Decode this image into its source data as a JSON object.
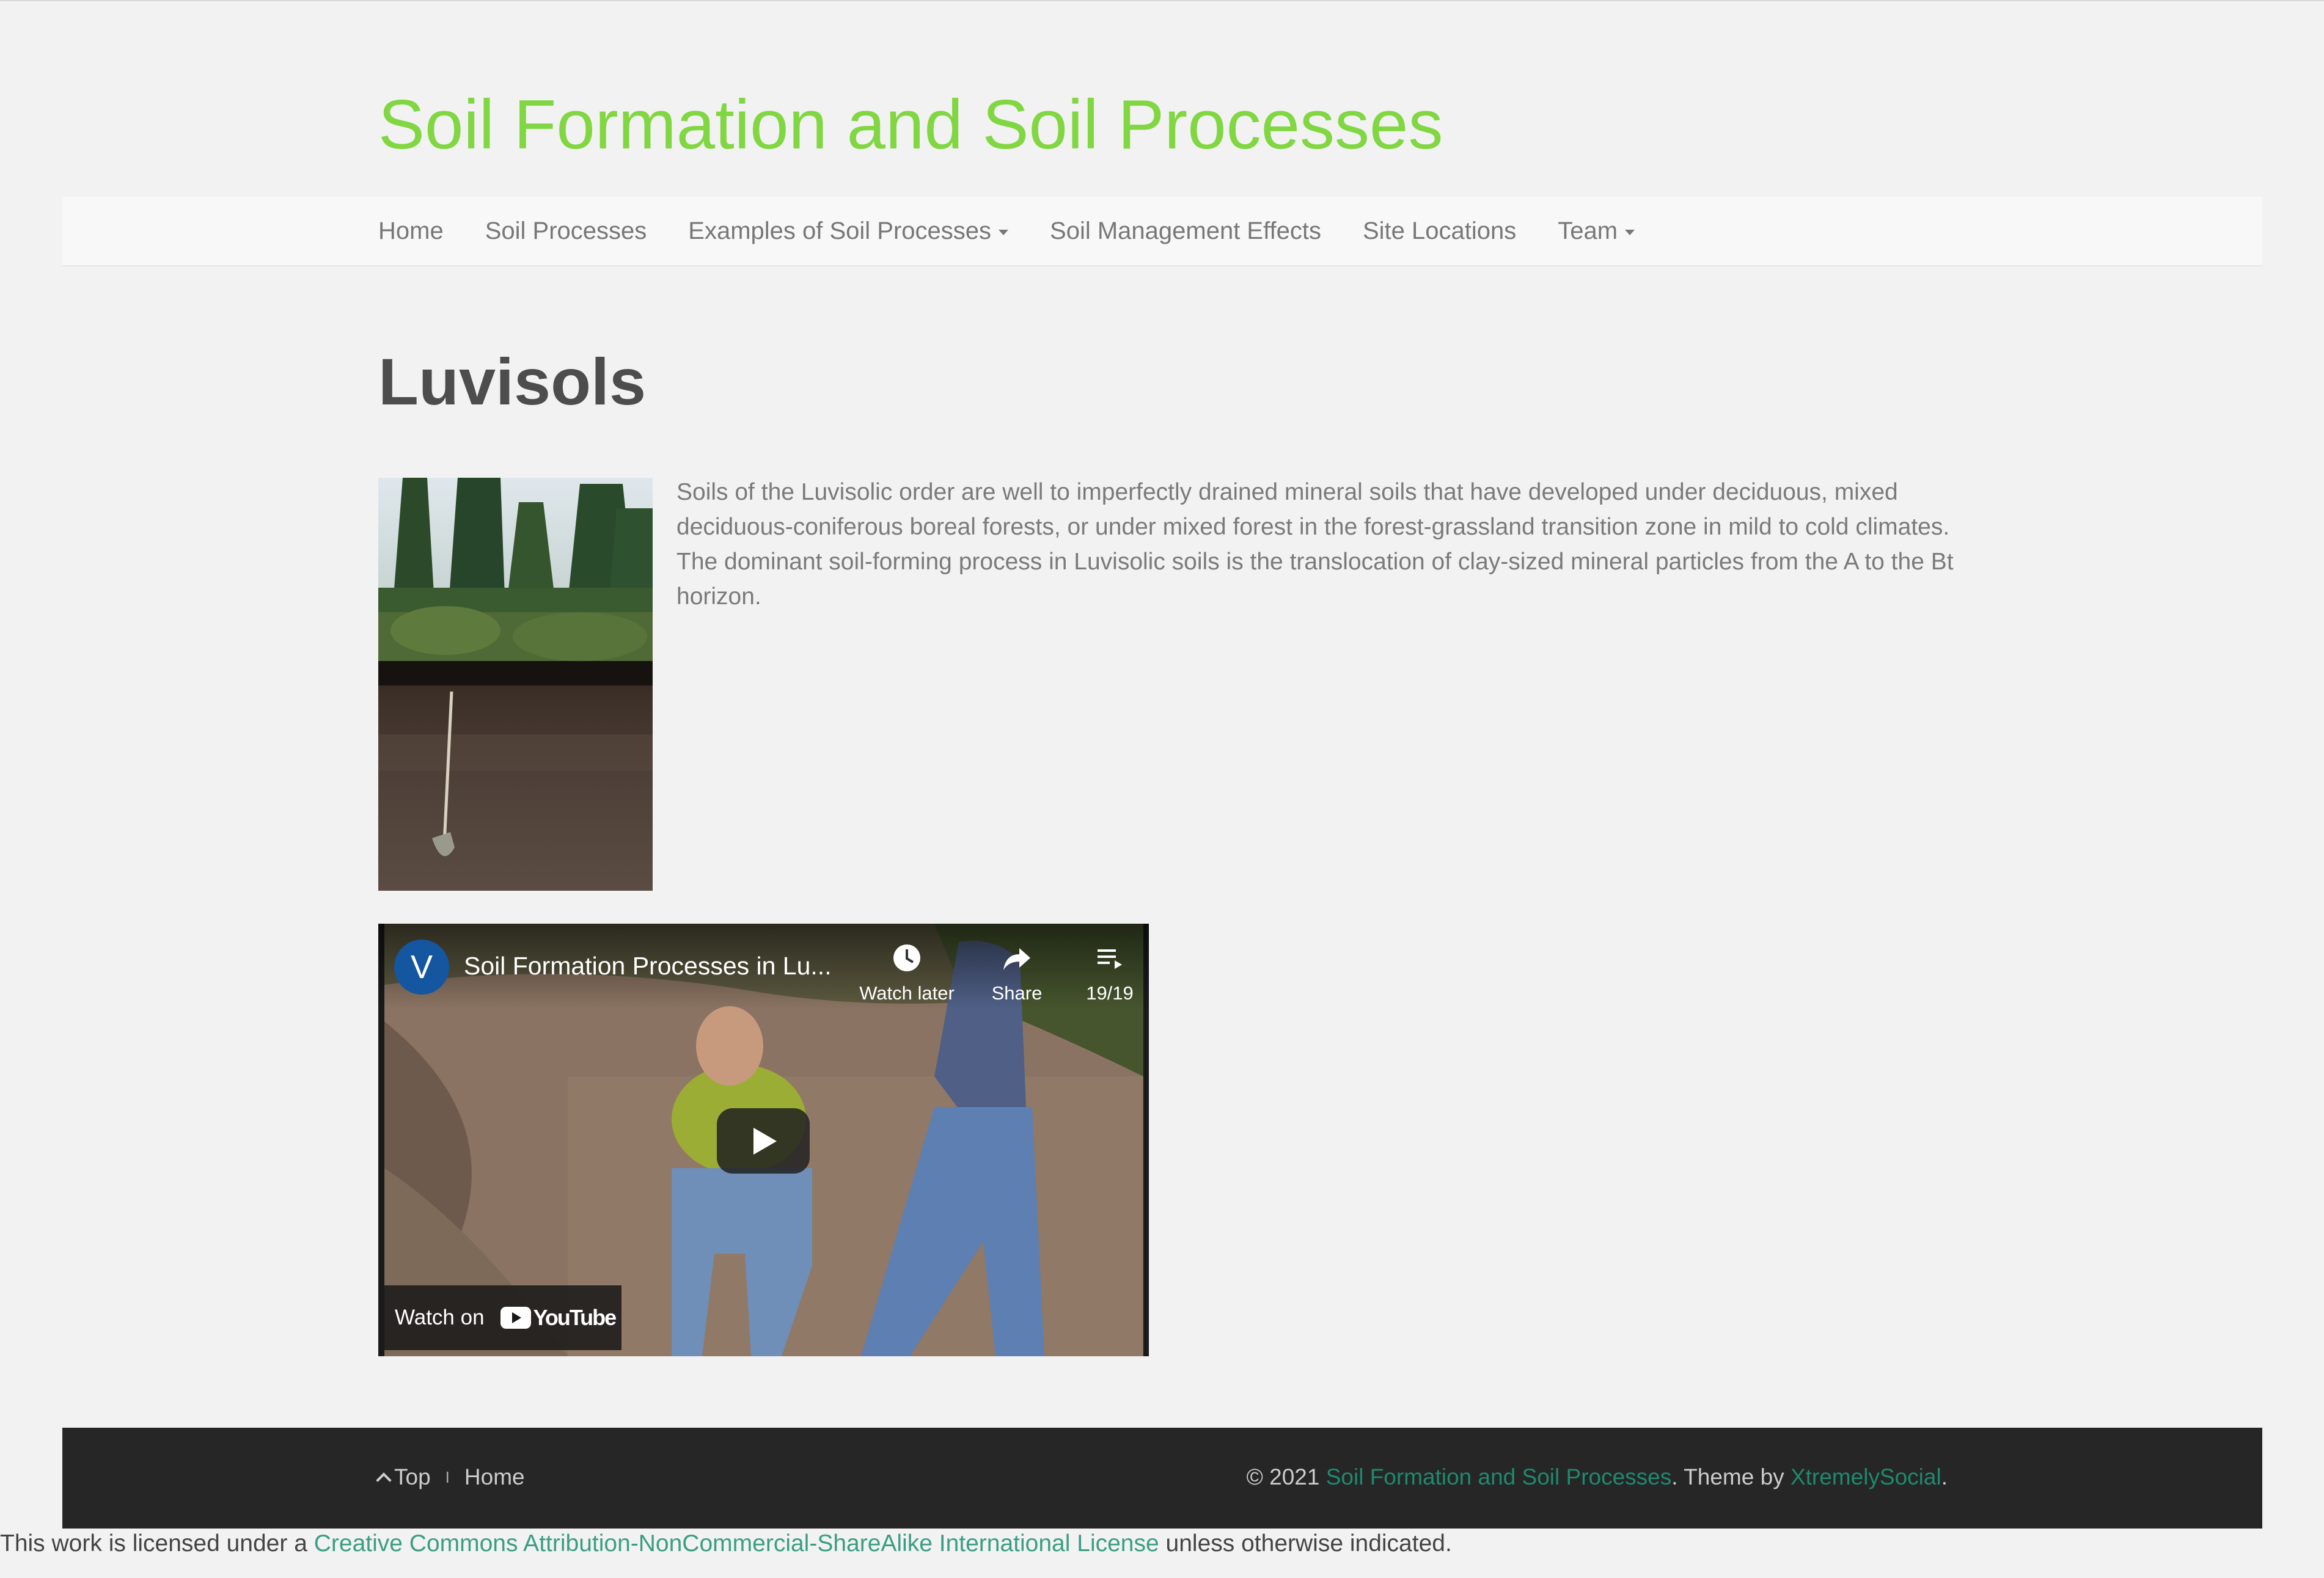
{
  "site": {
    "title": "Soil Formation and Soil Processes"
  },
  "nav": {
    "items": [
      {
        "label": "Home"
      },
      {
        "label": "Soil Processes"
      },
      {
        "label": "Examples of Soil Processes",
        "dropdown": true
      },
      {
        "label": "Soil Management Effects"
      },
      {
        "label": "Site Locations"
      },
      {
        "label": "Team",
        "dropdown": true
      }
    ]
  },
  "page": {
    "heading": "Luvisols",
    "description": "Soils of the Luvisolic order are well to imperfectly drained mineral soils that have developed under deciduous, mixed deciduous-coniferous boreal forests, or under mixed forest in the forest-grassland transition zone in mild to cold climates. The dominant soil-forming process in Luvisolic soils is the translocation of clay-sized mineral particles from the A to the Bt horizon."
  },
  "video": {
    "channel_initial": "V",
    "title": "Soil Formation Processes in Lu...",
    "watch_later": "Watch later",
    "share": "Share",
    "playlist_count": "19/19",
    "watch_on": "Watch on",
    "youtube": "YouTube"
  },
  "footer": {
    "top_label": "Top",
    "separator": "I",
    "home_label": "Home",
    "copyright_prefix": "© 2021",
    "site_link": "Soil Formation and Soil Processes",
    "theme_text": ". Theme by",
    "theme_link": "XtremelySocial",
    "end_period": "."
  },
  "license": {
    "prefix": "This work is licensed under a",
    "link": "Creative Commons Attribution-NonCommercial-ShareAlike International License",
    "suffix": "unless otherwise indicated."
  },
  "colors": {
    "title_green": "#81d742",
    "footer_link": "#1e8a6e",
    "license_link": "#3a9e82",
    "footer_bg": "#262626"
  }
}
